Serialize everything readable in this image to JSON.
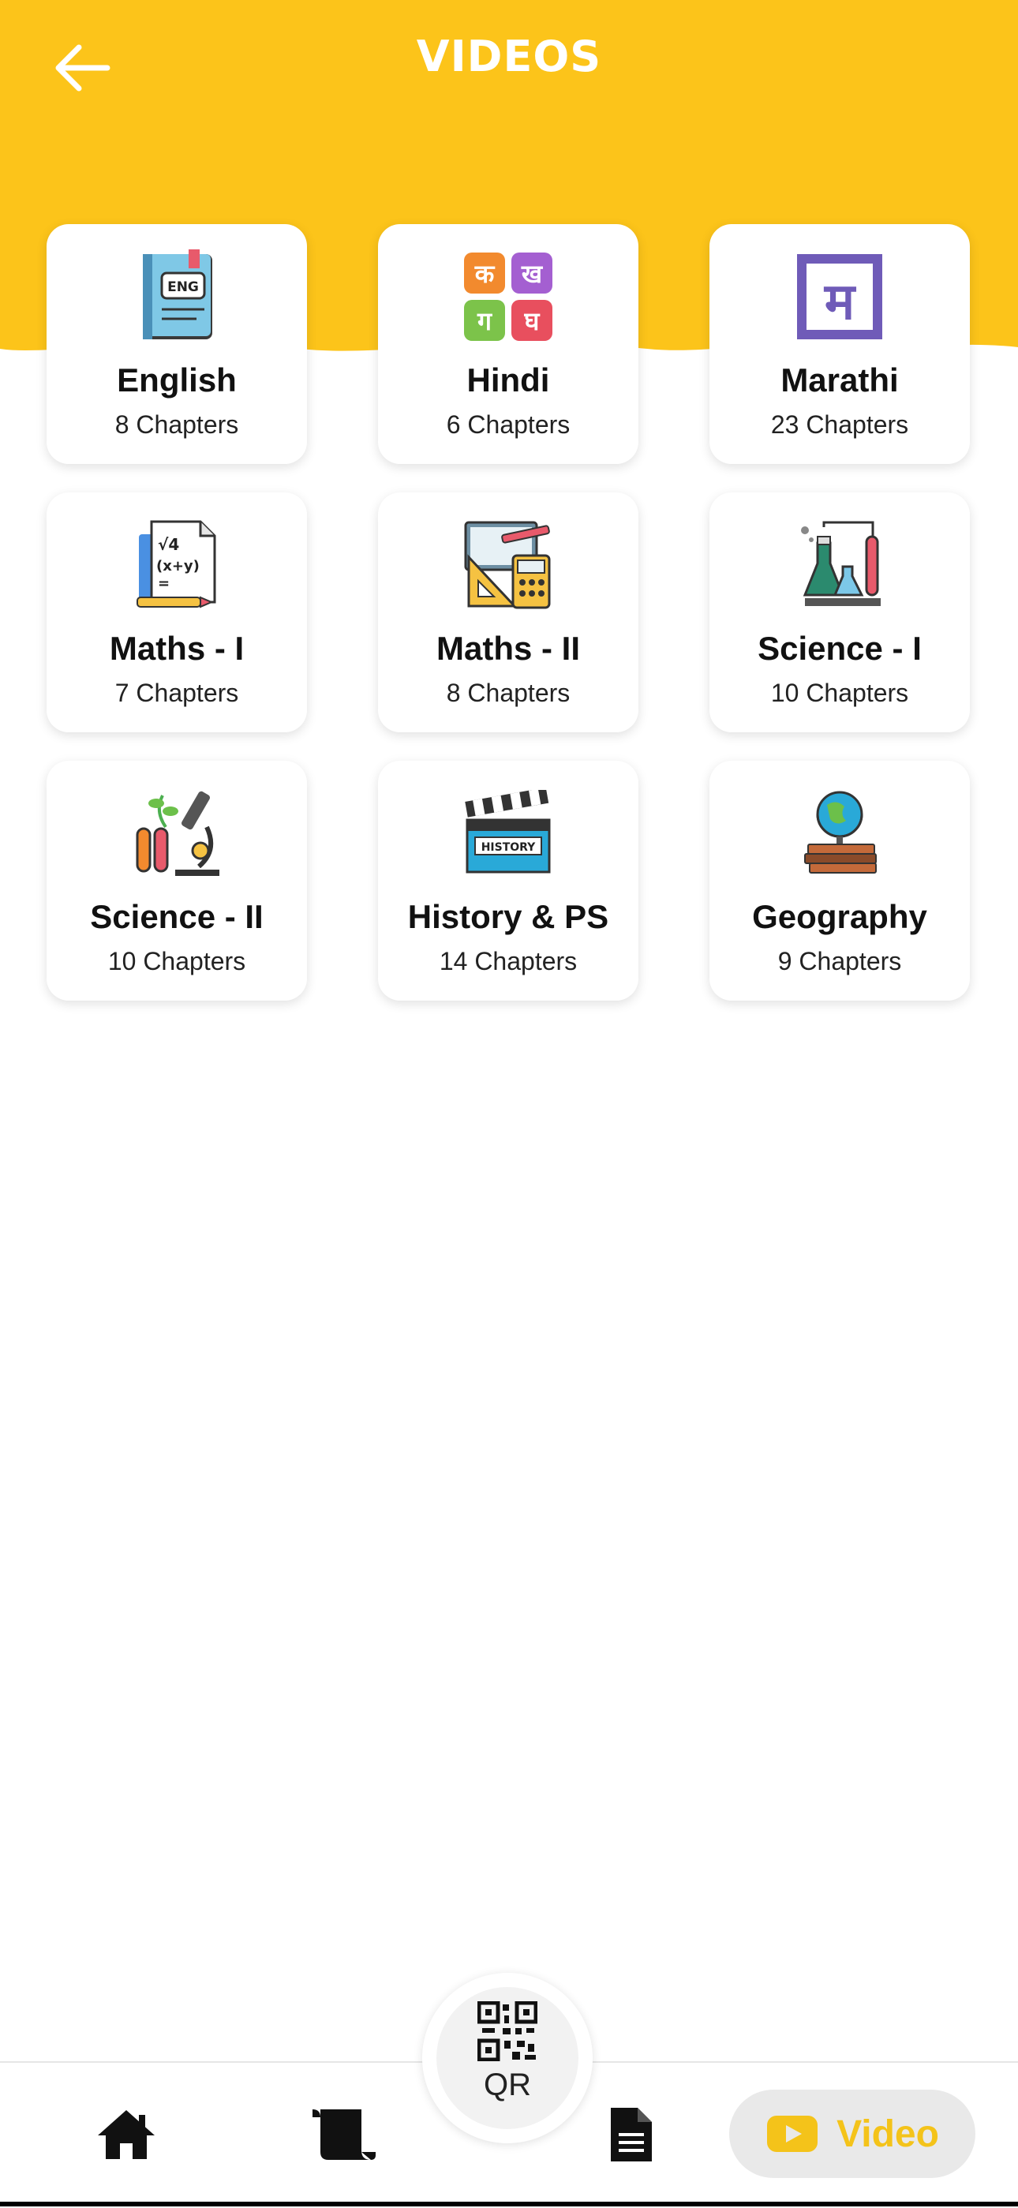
{
  "header": {
    "title": "VIDEOS"
  },
  "subjects": [
    {
      "name": "English",
      "chapters": "8 Chapters",
      "icon": "english-book-icon"
    },
    {
      "name": "Hindi",
      "chapters": "6 Chapters",
      "icon": "hindi-letters-icon"
    },
    {
      "name": "Marathi",
      "chapters": "23 Chapters",
      "icon": "marathi-letter-icon"
    },
    {
      "name": "Maths - I",
      "chapters": "7 Chapters",
      "icon": "maths-paper-icon"
    },
    {
      "name": "Maths - II",
      "chapters": "8 Chapters",
      "icon": "geometry-tools-icon"
    },
    {
      "name": "Science - I",
      "chapters": "10 Chapters",
      "icon": "chemistry-flasks-icon"
    },
    {
      "name": "Science - II",
      "chapters": "10 Chapters",
      "icon": "microscope-icon"
    },
    {
      "name": "History & PS",
      "chapters": "14 Chapters",
      "icon": "history-clapboard-icon"
    },
    {
      "name": "Geography",
      "chapters": "9 Chapters",
      "icon": "globe-books-icon"
    }
  ],
  "icon_text": {
    "english": "ENG",
    "hindi": [
      "क",
      "ख",
      "ग",
      "घ"
    ],
    "marathi": "म",
    "maths": [
      "√4",
      "(x+y)",
      "="
    ],
    "history": "HISTORY"
  },
  "bottom_nav": {
    "qr_label": "QR",
    "video_label": "Video"
  },
  "colors": {
    "header": "#FCC41A",
    "accent": "#F4C31A"
  }
}
